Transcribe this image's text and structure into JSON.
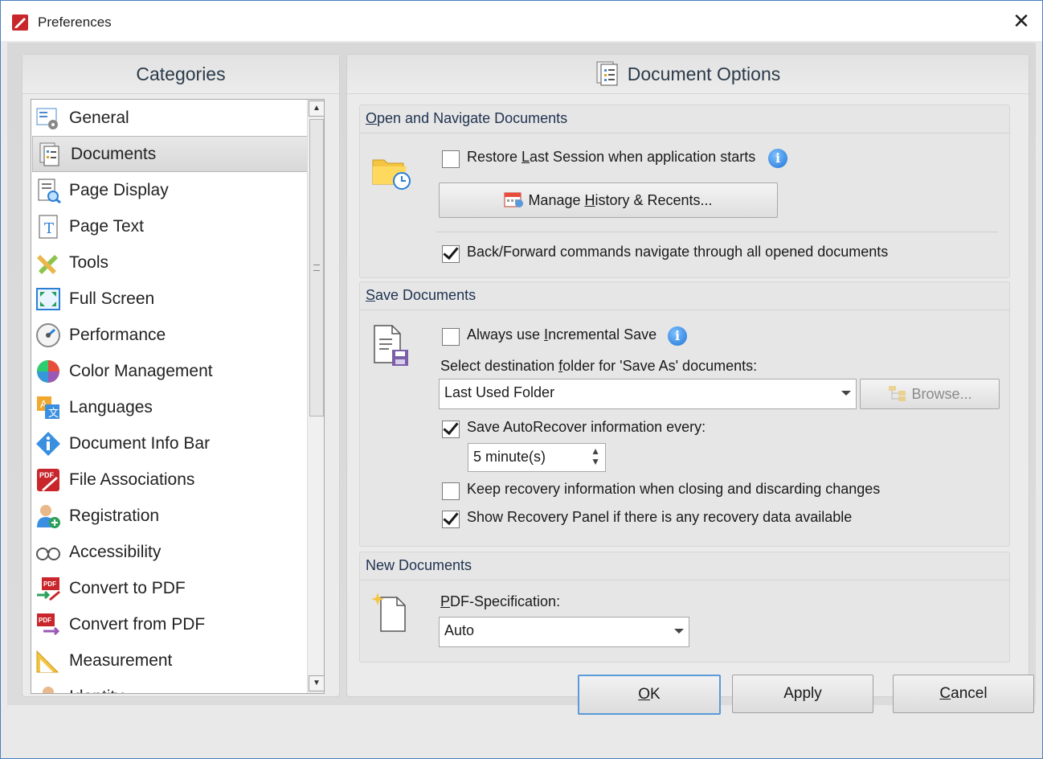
{
  "window": {
    "title": "Preferences",
    "close_glyph": "✕"
  },
  "categories": {
    "header": "Categories",
    "items": [
      {
        "label": "General",
        "icon": "general-settings-icon"
      },
      {
        "label": "Documents",
        "icon": "documents-icon",
        "selected": true
      },
      {
        "label": "Page Display",
        "icon": "page-display-icon"
      },
      {
        "label": "Page Text",
        "icon": "page-text-icon"
      },
      {
        "label": "Tools",
        "icon": "tools-icon"
      },
      {
        "label": "Full Screen",
        "icon": "full-screen-icon"
      },
      {
        "label": "Performance",
        "icon": "performance-gauge-icon"
      },
      {
        "label": "Color Management",
        "icon": "color-wheel-icon"
      },
      {
        "label": "Languages",
        "icon": "languages-icon"
      },
      {
        "label": "Document Info Bar",
        "icon": "info-diamond-icon"
      },
      {
        "label": "File Associations",
        "icon": "pdf-file-icon"
      },
      {
        "label": "Registration",
        "icon": "registration-user-icon"
      },
      {
        "label": "Accessibility",
        "icon": "glasses-icon"
      },
      {
        "label": "Convert to PDF",
        "icon": "convert-to-pdf-icon"
      },
      {
        "label": "Convert from PDF",
        "icon": "convert-from-pdf-icon"
      },
      {
        "label": "Measurement",
        "icon": "measurement-ruler-icon"
      },
      {
        "label": "Identity",
        "icon": "identity-user-icon"
      }
    ]
  },
  "options": {
    "header": "Document Options",
    "open_navigate": {
      "title_prefix": "O",
      "title_rest": "pen and Navigate Documents",
      "restore_session": {
        "label_a": "Restore ",
        "label_u": "L",
        "label_b": "ast Session when application starts",
        "checked": false
      },
      "manage_history": {
        "label_a": "Manage ",
        "label_u": "H",
        "label_b": "istory & Recents..."
      },
      "back_forward": {
        "label": "Back/Forward commands navigate through all opened documents",
        "checked": true
      }
    },
    "save_documents": {
      "title_prefix": "S",
      "title_rest": "ave Documents",
      "incremental": {
        "label_a": "Always use ",
        "label_u": "I",
        "label_b": "ncremental Save",
        "checked": false
      },
      "dest_folder_label_a": "Select destination ",
      "dest_folder_label_u": "f",
      "dest_folder_label_b": "older for 'Save As' documents:",
      "dest_folder_value": "Last Used Folder",
      "browse": "Browse...",
      "autorecover": {
        "label": "Save AutoRecover information every:",
        "checked": true
      },
      "interval_value": "5 minute(s)",
      "keep_recovery": {
        "label": "Keep recovery information when closing and discarding changes",
        "checked": false
      },
      "show_recovery_panel": {
        "label": "Show Recovery Panel if there is any recovery data available",
        "checked": true
      }
    },
    "new_documents": {
      "title": "New Documents",
      "pdf_spec_label_u": "P",
      "pdf_spec_label_rest": "DF-Specification:",
      "pdf_spec_value": "Auto"
    }
  },
  "footer": {
    "ok_u": "O",
    "ok_rest": "K",
    "apply": "Apply",
    "cancel_u": "C",
    "cancel_rest": "ancel"
  },
  "colors": {
    "accent": "#1e73d6",
    "window_border": "#4a7fc0",
    "default_button_border": "#5a9ad8"
  }
}
